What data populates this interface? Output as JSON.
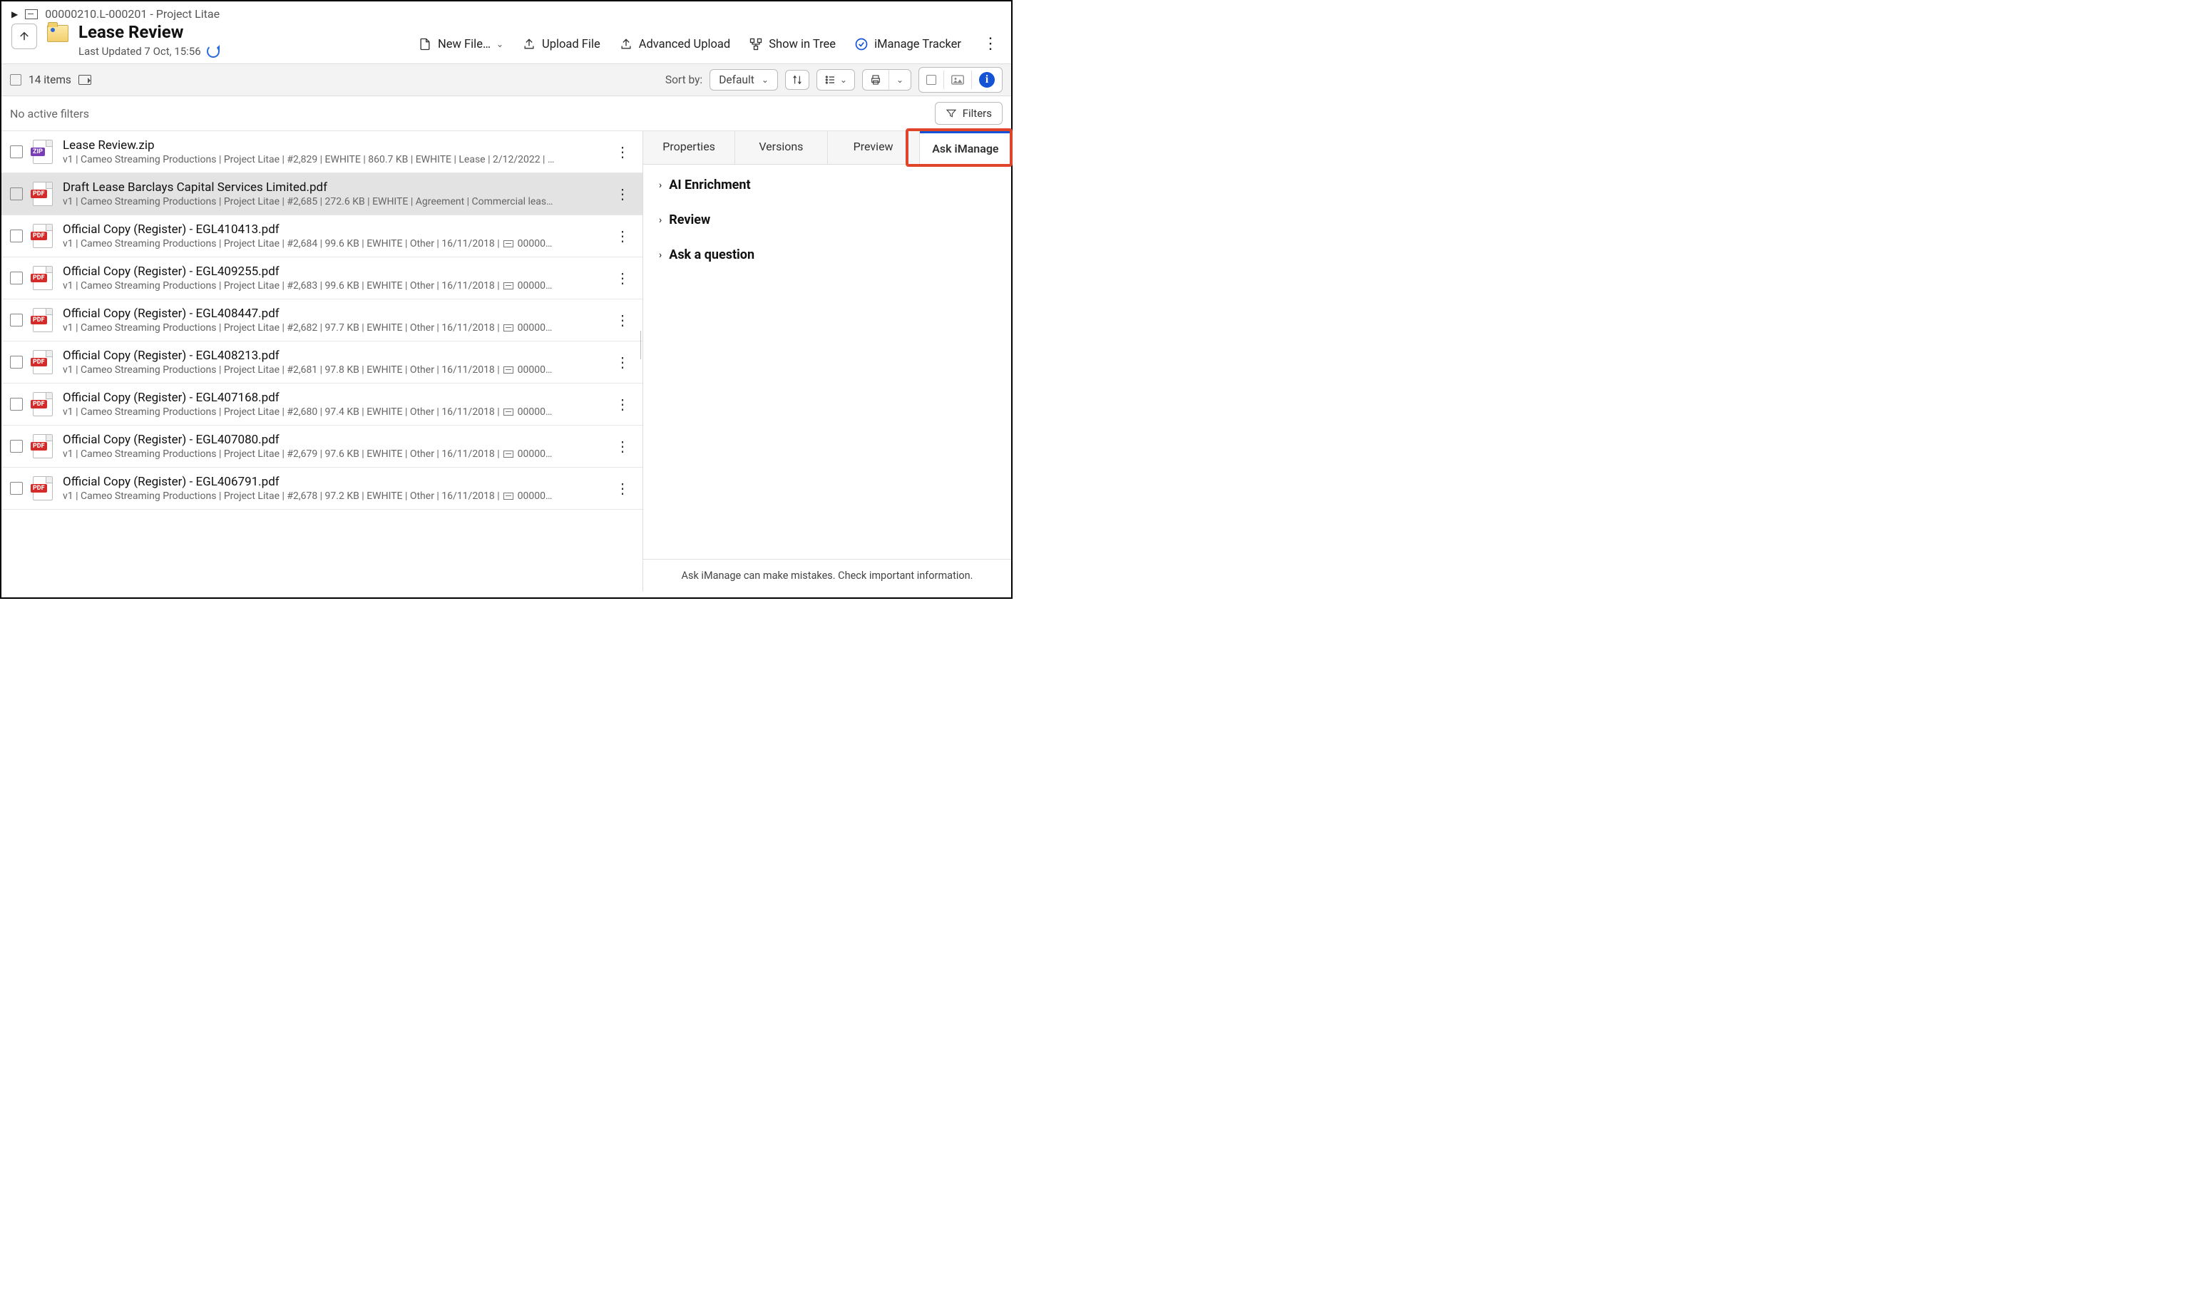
{
  "breadcrumb": {
    "ref": "00000210.L-000201 - Project Litae"
  },
  "header": {
    "title": "Lease Review",
    "last_updated": "Last Updated 7 Oct, 15:56"
  },
  "actions": {
    "new_file": "New File…",
    "upload_file": "Upload File",
    "advanced_upload": "Advanced Upload",
    "show_in_tree": "Show in Tree",
    "tracker": "iManage Tracker"
  },
  "toolbar": {
    "item_count": "14 items",
    "sort_by_label": "Sort by:",
    "sort_value": "Default"
  },
  "filters": {
    "none_label": "No active filters",
    "button": "Filters"
  },
  "files": [
    {
      "type": "zip",
      "name": "Lease Review.zip",
      "meta_plain": "v1 | Cameo Streaming Productions | Project Litae | #2,829 | EWHITE | 860.7 KB | EWHITE | Lease | 2/12/2022 | …",
      "selected": false
    },
    {
      "type": "pdf",
      "name": "Draft Lease Barclays Capital Services Limited.pdf",
      "meta_plain": "v1 | Cameo Streaming Productions | Project Litae | #2,685 | 272.6 KB | EWHITE | Agreement | Commercial leas…",
      "selected": true
    },
    {
      "type": "pdf",
      "name": "Official Copy (Register) - EGL410413.pdf",
      "meta_prefix": "v1 | Cameo Streaming Productions | Project Litae | #2,684 | 99.6 KB | EWHITE | Other | 16/11/2018 | ",
      "meta_suffix": " 00000…",
      "has_ref_icon": true,
      "selected": false
    },
    {
      "type": "pdf",
      "name": "Official Copy (Register) - EGL409255.pdf",
      "meta_prefix": "v1 | Cameo Streaming Productions | Project Litae | #2,683 | 99.6 KB | EWHITE | Other | 16/11/2018 | ",
      "meta_suffix": " 00000…",
      "has_ref_icon": true,
      "selected": false
    },
    {
      "type": "pdf",
      "name": "Official Copy (Register) - EGL408447.pdf",
      "meta_prefix": "v1 | Cameo Streaming Productions | Project Litae | #2,682 | 97.7 KB | EWHITE | Other | 16/11/2018 | ",
      "meta_suffix": " 00000…",
      "has_ref_icon": true,
      "selected": false
    },
    {
      "type": "pdf",
      "name": "Official Copy (Register) - EGL408213.pdf",
      "meta_prefix": "v1 | Cameo Streaming Productions | Project Litae | #2,681 | 97.8 KB | EWHITE | Other | 16/11/2018 | ",
      "meta_suffix": " 00000…",
      "has_ref_icon": true,
      "selected": false
    },
    {
      "type": "pdf",
      "name": "Official Copy (Register) - EGL407168.pdf",
      "meta_prefix": "v1 | Cameo Streaming Productions | Project Litae | #2,680 | 97.4 KB | EWHITE | Other | 16/11/2018 | ",
      "meta_suffix": " 00000…",
      "has_ref_icon": true,
      "selected": false
    },
    {
      "type": "pdf",
      "name": "Official Copy (Register) - EGL407080.pdf",
      "meta_prefix": "v1 | Cameo Streaming Productions | Project Litae | #2,679 | 97.6 KB | EWHITE | Other | 16/11/2018 | ",
      "meta_suffix": " 00000…",
      "has_ref_icon": true,
      "selected": false
    },
    {
      "type": "pdf",
      "name": "Official Copy (Register) - EGL406791.pdf",
      "meta_prefix": "v1 | Cameo Streaming Productions | Project Litae | #2,678 | 97.2 KB | EWHITE | Other | 16/11/2018 | ",
      "meta_suffix": " 00000…",
      "has_ref_icon": true,
      "selected": false
    }
  ],
  "right_tabs": {
    "properties": "Properties",
    "versions": "Versions",
    "preview": "Preview",
    "ask": "Ask iManage"
  },
  "ask_panel": {
    "sections": [
      "AI Enrichment",
      "Review",
      "Ask a question"
    ],
    "disclaimer": "Ask iManage can make mistakes. Check important information."
  }
}
